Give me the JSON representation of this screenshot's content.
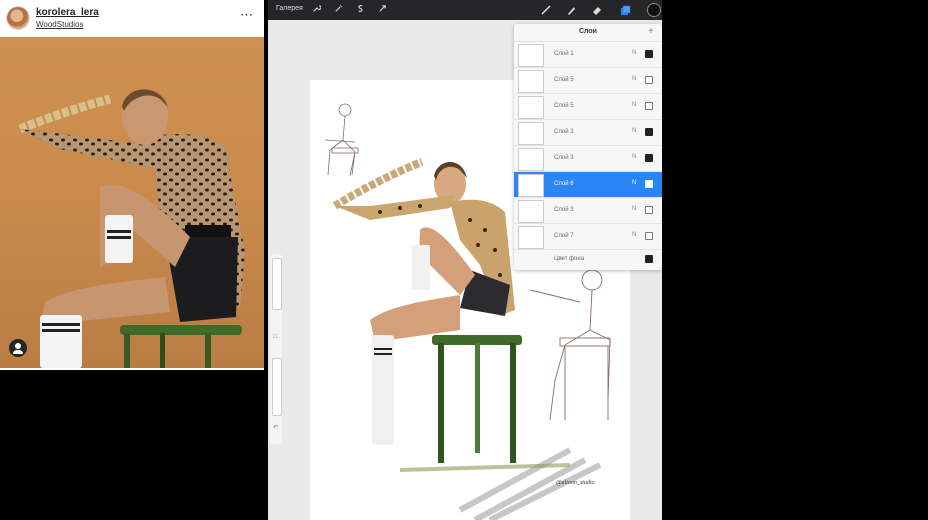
{
  "instagram": {
    "username": "korolera_lera",
    "location": "WoodStudios",
    "more_icon": "⋯"
  },
  "toolbar": {
    "gallery": "Галерея",
    "left_tools": [
      "wrench-icon",
      "magic-wand-icon",
      "selection-icon",
      "transform-icon"
    ],
    "right_tools": [
      "brush-icon",
      "smudge-icon",
      "eraser-icon",
      "layers-icon",
      "color-icon"
    ],
    "accent_color": "#2a86f5"
  },
  "layers_panel": {
    "title": "Слои",
    "add_symbol": "+",
    "layers": [
      {
        "name": "Слой 1",
        "blend": "N",
        "visible": true,
        "active": false
      },
      {
        "name": "Слой 5",
        "blend": "N",
        "visible": false,
        "active": false
      },
      {
        "name": "Слой 5",
        "blend": "N",
        "visible": false,
        "active": false
      },
      {
        "name": "Слой 3",
        "blend": "N",
        "visible": true,
        "active": false
      },
      {
        "name": "Слой 3",
        "blend": "N",
        "visible": true,
        "active": false
      },
      {
        "name": "Слой 6",
        "blend": "N",
        "visible": true,
        "active": true
      },
      {
        "name": "Слой 3",
        "blend": "N",
        "visible": false,
        "active": false
      },
      {
        "name": "Слой 7",
        "blend": "N",
        "visible": false,
        "active": false
      }
    ],
    "background_layer": {
      "name": "Цвет фона",
      "visible": true
    }
  },
  "canvas": {
    "signature": "@alionn_studio"
  }
}
